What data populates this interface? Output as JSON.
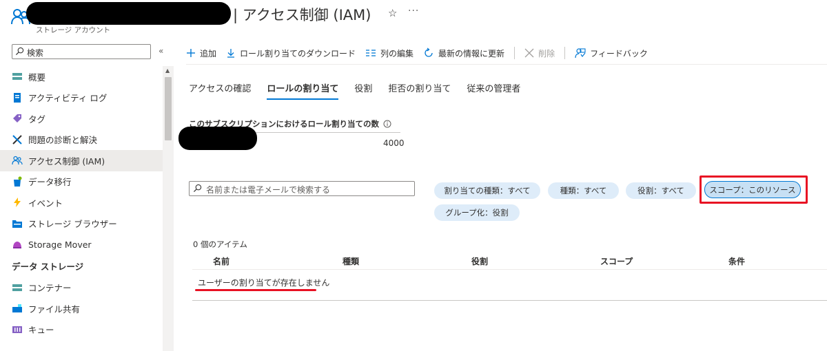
{
  "header": {
    "title": "| アクセス制御 (IAM)",
    "subtitle": "ストレージ アカウント",
    "star": "☆",
    "more": "···"
  },
  "sidebar": {
    "search_placeholder": "検索",
    "collapse": "«",
    "items": [
      {
        "label": "概要",
        "icon": "overview-icon"
      },
      {
        "label": "アクティビティ ログ",
        "icon": "activity-log-icon"
      },
      {
        "label": "タグ",
        "icon": "tag-icon"
      },
      {
        "label": "問題の診断と解決",
        "icon": "diagnose-icon"
      },
      {
        "label": "アクセス制御 (IAM)",
        "icon": "access-control-icon"
      },
      {
        "label": "データ移行",
        "icon": "data-migration-icon"
      },
      {
        "label": "イベント",
        "icon": "events-icon"
      },
      {
        "label": "ストレージ ブラウザー",
        "icon": "storage-browser-icon"
      },
      {
        "label": "Storage Mover",
        "icon": "storage-mover-icon"
      }
    ],
    "section": "データ ストレージ",
    "section_items": [
      {
        "label": "コンテナー",
        "icon": "containers-icon"
      },
      {
        "label": "ファイル共有",
        "icon": "file-share-icon"
      },
      {
        "label": "キュー",
        "icon": "queue-icon"
      }
    ]
  },
  "toolbar": {
    "add": "追加",
    "download": "ロール割り当てのダウンロード",
    "edit_columns": "列の編集",
    "refresh": "最新の情報に更新",
    "delete": "削除",
    "feedback": "フィードバック"
  },
  "tabs": [
    "アクセスの確認",
    "ロールの割り当て",
    "役割",
    "拒否の割り当て",
    "従来の管理者"
  ],
  "active_tab": "ロールの割り当て",
  "assignments": {
    "title": "このサブスクリプションにおけるロール割り当ての数",
    "max": "4000"
  },
  "filter": {
    "search_placeholder": "名前または電子メールで検索する",
    "pills": [
      "割り当ての種類：すべて",
      "種類：すべて",
      "役割：すべて",
      "スコープ：このリソース",
      "グループ化：役割"
    ]
  },
  "table": {
    "item_count": "0 個のアイテム",
    "columns": [
      "名前",
      "種類",
      "役割",
      "スコープ",
      "条件"
    ],
    "empty_message": "ユーザーの割り当てが存在しません"
  },
  "colors": {
    "accent": "#0078d4",
    "pill": "#deecf9",
    "highlight": "#e81123"
  }
}
